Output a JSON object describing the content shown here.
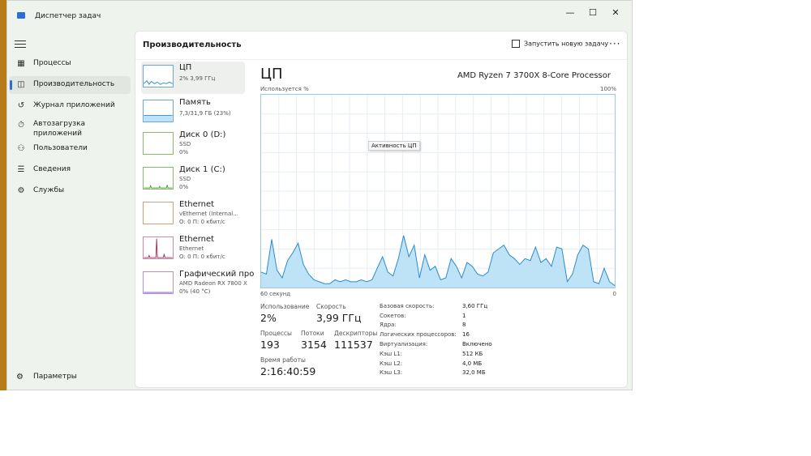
{
  "window": {
    "title": "Диспетчер задач",
    "controls": [
      "—",
      "☐",
      "✕"
    ]
  },
  "nav": {
    "items": [
      {
        "label": "Процессы",
        "icon": "processes-icon",
        "active": false
      },
      {
        "label": "Производительность",
        "icon": "performance-icon",
        "active": true
      },
      {
        "label": "Журнал приложений",
        "icon": "app-history-icon",
        "active": false
      },
      {
        "label": "Автозагрузка приложений",
        "icon": "startup-icon",
        "active": false
      },
      {
        "label": "Пользователи",
        "icon": "users-icon",
        "active": false
      },
      {
        "label": "Сведения",
        "icon": "details-icon",
        "active": false
      },
      {
        "label": "Службы",
        "icon": "services-icon",
        "active": false
      }
    ],
    "settings_label": "Параметры"
  },
  "header": {
    "title": "Производительность",
    "run_task_label": "Запустить новую задачу",
    "more_label": "···"
  },
  "resources": [
    {
      "name": "ЦП",
      "sub1": "2% 3,99 ГГц",
      "sub2": "",
      "active": true,
      "color": "#2a8ad0"
    },
    {
      "name": "Память",
      "sub1": "7,3/31,9 ГБ (23%)",
      "sub2": "",
      "active": false,
      "color": "#2a8ad0"
    },
    {
      "name": "Диск 0 (D:)",
      "sub1": "SSD",
      "sub2": "0%",
      "active": false,
      "color": "#4a9a2a"
    },
    {
      "name": "Диск 1 (C:)",
      "sub1": "SSD",
      "sub2": "0%",
      "active": false,
      "color": "#4a9a2a"
    },
    {
      "name": "Ethernet",
      "sub1": "vEthernet (Internal...",
      "sub2": "О: 0 П: 0 кбит/с",
      "active": false,
      "color": "#a0522d"
    },
    {
      "name": "Ethernet",
      "sub1": "Ethernet",
      "sub2": "О: 0 П: 0 кбит/с",
      "active": false,
      "color": "#a0305a"
    },
    {
      "name": "Графический про",
      "sub1": "AMD Radeon RX 7800 X",
      "sub2": "0% (40 °C)",
      "active": false,
      "color": "#7a40c0"
    }
  ],
  "detail": {
    "title": "ЦП",
    "model": "AMD Ryzen 7 3700X 8-Core Processor",
    "usage_axis_label": "Используется %",
    "max_label": "100%",
    "time_label": "60 секунд",
    "zero_label": "0",
    "tooltip": "Активность ЦП",
    "stats": {
      "usage_label": "Использование",
      "usage_value": "2%",
      "speed_label": "Скорость",
      "speed_value": "3,99 ГГц",
      "processes_label": "Процессы",
      "processes_value": "193",
      "threads_label": "Потоки",
      "threads_value": "3154",
      "handles_label": "Дескрипторы",
      "handles_value": "111537",
      "uptime_label": "Время работы",
      "uptime_value": "2:16:40:59"
    },
    "specs": [
      {
        "label": "Базовая скорость:",
        "value": "3,60 ГГц"
      },
      {
        "label": "Сокетов:",
        "value": "1"
      },
      {
        "label": "Ядра:",
        "value": "8"
      },
      {
        "label": "Логических процессоров:",
        "value": "16"
      },
      {
        "label": "Виртуализация:",
        "value": "Включено"
      },
      {
        "label": "Кэш L1:",
        "value": "512 КБ"
      },
      {
        "label": "Кэш L2:",
        "value": "4,0 МБ"
      },
      {
        "label": "Кэш L3:",
        "value": "32,0 МБ"
      }
    ]
  },
  "chart_data": {
    "type": "area",
    "ylim": [
      0,
      100
    ],
    "values": [
      8,
      7,
      25,
      9,
      5,
      14,
      18,
      23,
      12,
      7,
      4,
      3,
      2,
      2,
      4,
      3,
      4,
      3,
      3,
      4,
      3,
      4,
      10,
      16,
      8,
      6,
      15,
      27,
      16,
      22,
      5,
      17,
      9,
      11,
      4,
      5,
      15,
      11,
      5,
      13,
      11,
      7,
      6,
      8,
      18,
      20,
      22,
      17,
      15,
      12,
      15,
      14,
      21,
      13,
      15,
      11,
      21,
      20,
      3,
      7,
      17,
      22,
      20,
      3,
      2,
      10,
      3,
      1
    ]
  },
  "colors": {
    "accent": "#2a6fd6",
    "graph_line": "#2a8ad0",
    "graph_fill": "#bfe3f6"
  }
}
